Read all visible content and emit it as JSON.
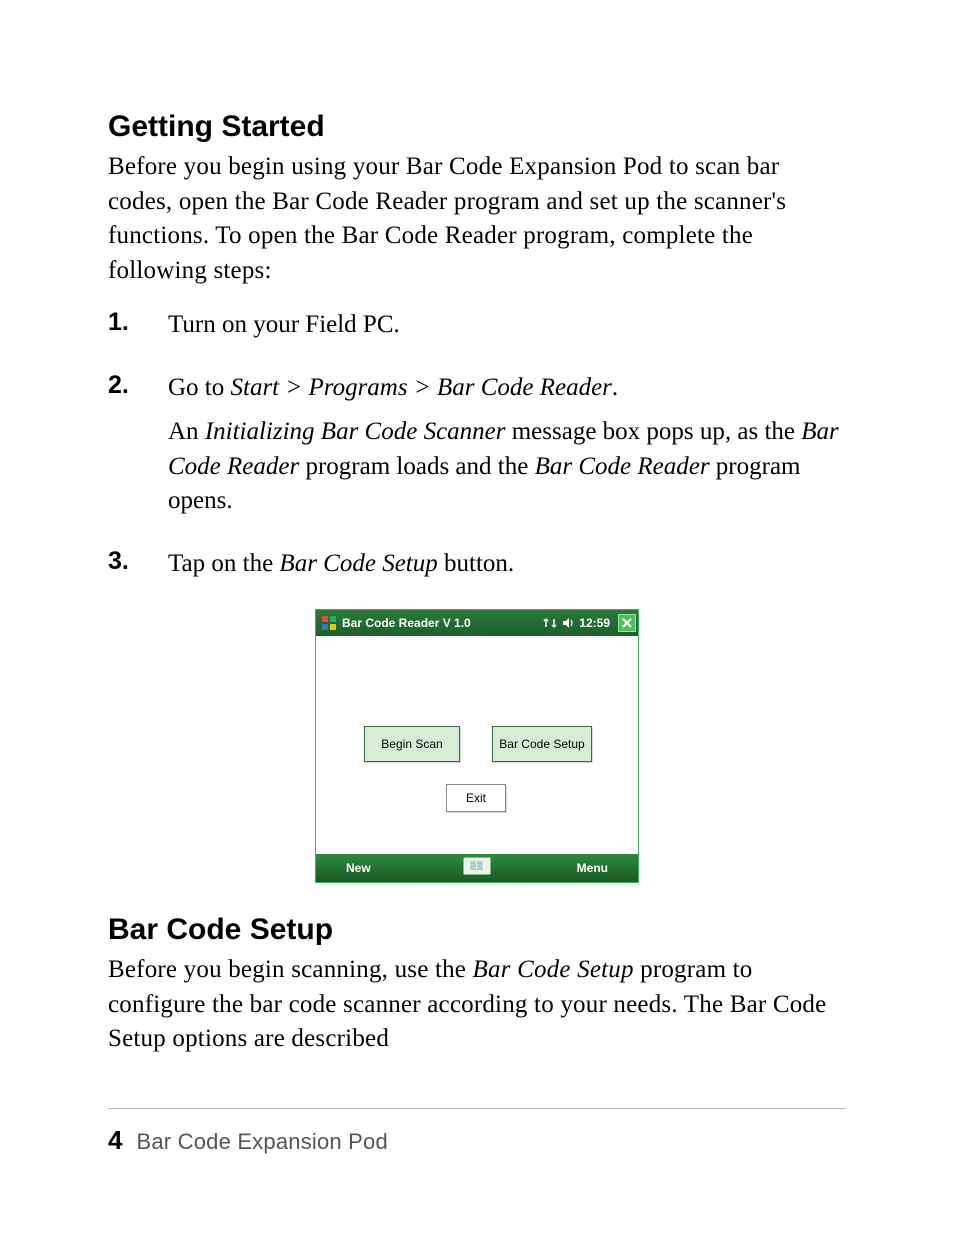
{
  "sections": {
    "getting_started": {
      "heading": "Getting Started",
      "intro": "Before you begin using your Bar Code Expansion Pod to scan bar codes, open the Bar Code Reader program and set up the scanner's functions. To open the Bar Code Reader program, complete the following steps:",
      "steps": [
        {
          "num": "1.",
          "lines": [
            "Turn on your Field PC."
          ]
        },
        {
          "num": "2.",
          "lines": [
            "Go to <em class=\"ui\">Start &gt; Programs &gt; Bar Code Reader</em>.",
            "An <em class=\"ui\">Initializing Bar Code Scanner</em> message box pops up, as the <em class=\"ui\">Bar Code Reader</em> program loads and the <em class=\"ui\">Bar Code Reader</em> program opens."
          ]
        },
        {
          "num": "3.",
          "lines": [
            "Tap on the <em class=\"ui\">Bar Code Setup</em> button."
          ]
        }
      ]
    },
    "bar_code_setup": {
      "heading": "Bar Code Setup",
      "intro": "Before you begin scanning, use the <em class=\"ui\">Bar Code Setup</em> program to configure the bar code scanner according to your needs. The Bar Code Setup options are described"
    }
  },
  "screenshot": {
    "titlebar": {
      "title": "Bar Code Reader V 1.0",
      "time": "12:59"
    },
    "buttons": {
      "begin": "Begin Scan",
      "setup": "Bar Code Setup",
      "exit": "Exit"
    },
    "softbar": {
      "left": "New",
      "right": "Menu"
    }
  },
  "footer": {
    "page": "4",
    "title": "Bar Code Expansion Pod"
  }
}
